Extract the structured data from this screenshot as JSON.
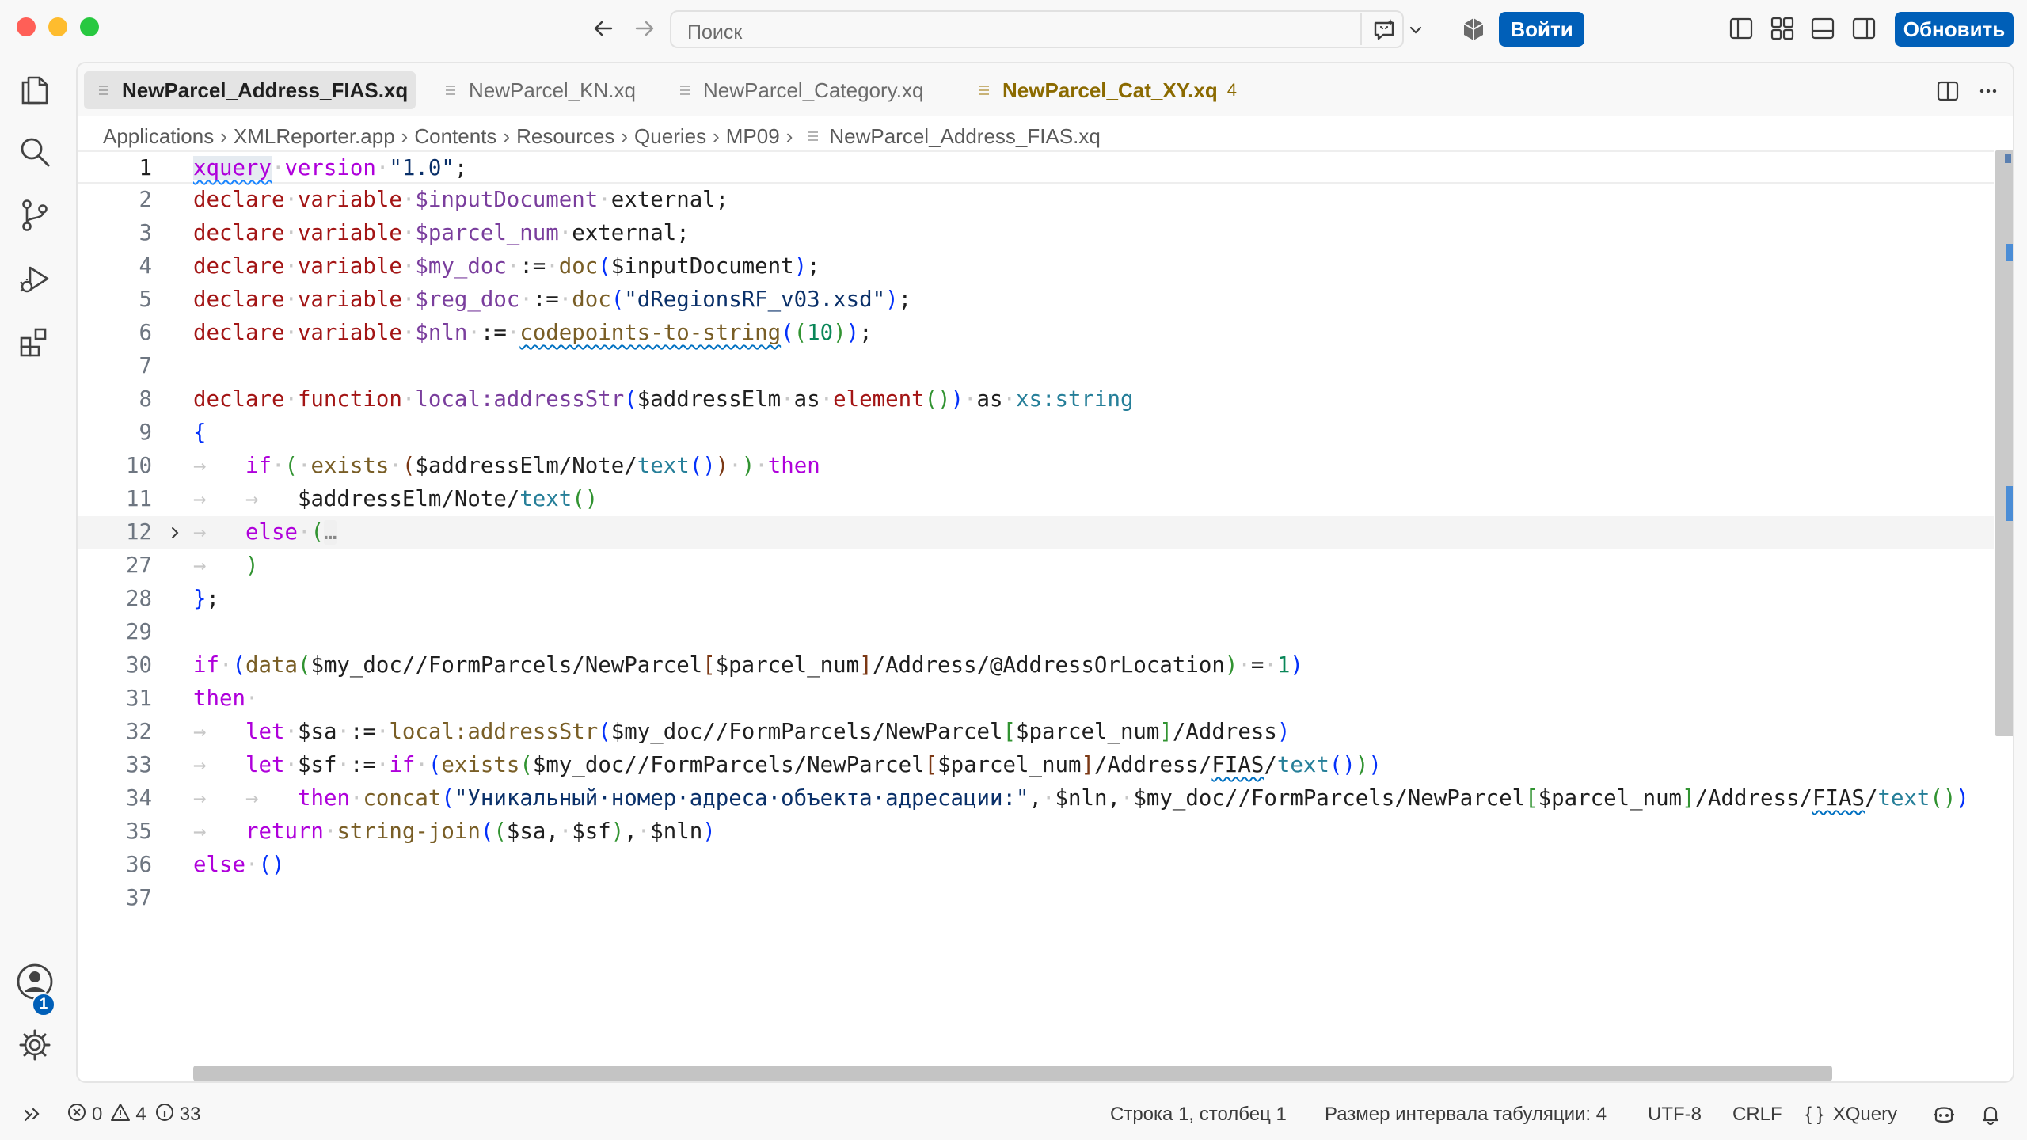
{
  "titlebar": {
    "search_placeholder": "Поиск",
    "signin_label": "Войти",
    "update_label": "Обновить"
  },
  "tabs": [
    {
      "label": "NewParcel_Address_FIAS.xq",
      "active": true
    },
    {
      "label": "NewParcel_KN.xq",
      "active": false
    },
    {
      "label": "NewParcel_Category.xq",
      "active": false
    },
    {
      "label": "NewParcel_Cat_XY.xq",
      "active": false,
      "problems": "4"
    }
  ],
  "breadcrumb": [
    "Applications",
    "XMLReporter.app",
    "Contents",
    "Resources",
    "Queries",
    "MP09",
    "NewParcel_Address_FIAS.xq"
  ],
  "code": {
    "line_numbers": [
      "1",
      "2",
      "3",
      "4",
      "5",
      "6",
      "7",
      "8",
      "9",
      "10",
      "11",
      "12",
      "27",
      "28",
      "29",
      "30",
      "31",
      "32",
      "33",
      "34",
      "35",
      "36",
      "37"
    ],
    "current_line": "1",
    "folded_line": "12"
  },
  "statusbar": {
    "errors": "0",
    "warnings": "4",
    "info": "33",
    "cursor": "Строка 1, столбец 1",
    "indent": "Размер интервала табуляции: 4",
    "encoding": "UTF-8",
    "eol": "CRLF",
    "language": "XQuery"
  },
  "activity": {
    "settings_badge": "1"
  },
  "colors": {
    "accent": "#005fb8",
    "keyword": "#af00db",
    "declare": "#a31515",
    "variable": "#7a3e9d",
    "string": "#0a3069",
    "function": "#795e26"
  },
  "icons": [
    "files-icon",
    "search-icon",
    "source-control-icon",
    "run-debug-icon",
    "extensions-icon",
    "account-icon",
    "settings-icon",
    "arrow-left-icon",
    "arrow-right-icon",
    "copilot-icon",
    "chevron-down-icon",
    "cube-icon",
    "layout-sidebar-left-icon",
    "layout-grid-icon",
    "layout-panel-icon",
    "layout-sidebar-right-icon",
    "split-editor-icon",
    "more-icon",
    "remote-icon",
    "error-icon",
    "warning-icon",
    "info-icon",
    "braces-icon",
    "copilot-status-icon",
    "bell-icon"
  ]
}
